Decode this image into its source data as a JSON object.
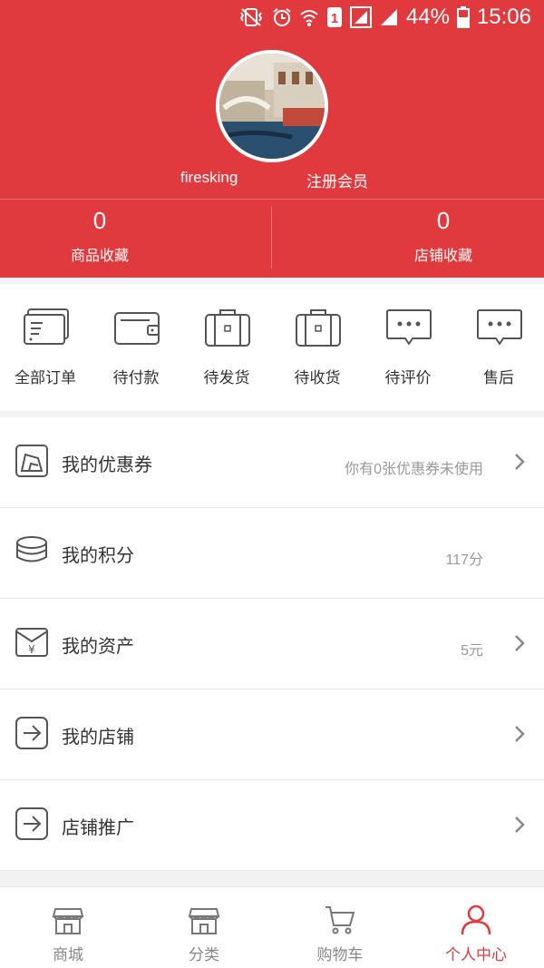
{
  "status_bar": {
    "battery": "44%",
    "time": "15:06",
    "sim": "1"
  },
  "profile": {
    "username": "firesking",
    "member_link": "注册会员"
  },
  "stats": [
    {
      "value": "0",
      "label": "商品收藏"
    },
    {
      "value": "0",
      "label": "店铺收藏"
    }
  ],
  "orders": [
    {
      "label": "全部订单",
      "icon": "order-list-icon"
    },
    {
      "label": "待付款",
      "icon": "wallet-icon"
    },
    {
      "label": "待发货",
      "icon": "suitcase-icon"
    },
    {
      "label": "待收货",
      "icon": "suitcase-icon"
    },
    {
      "label": "待评价",
      "icon": "chat-bubble-icon"
    },
    {
      "label": "售后",
      "icon": "chat-bubble-icon"
    }
  ],
  "menu": [
    {
      "label": "我的优惠券",
      "value": "你有0张优惠券未使用",
      "icon": "coupon-icon"
    },
    {
      "label": "我的积分",
      "value": "117分",
      "icon": "coins-icon"
    },
    {
      "label": "我的资产",
      "value": "5元",
      "icon": "envelope-yen-icon"
    },
    {
      "label": "我的店铺",
      "value": "",
      "icon": "store-arrow-icon"
    },
    {
      "label": "店铺推广",
      "value": "",
      "icon": "store-arrow-icon"
    }
  ],
  "bottom_nav": [
    {
      "label": "商城",
      "icon": "shop-icon"
    },
    {
      "label": "分类",
      "icon": "shop-icon"
    },
    {
      "label": "购物车",
      "icon": "cart-icon"
    },
    {
      "label": "个人中心",
      "icon": "person-icon",
      "active": true
    }
  ],
  "colors": {
    "brand": "#e13a3e",
    "text": "#333333",
    "muted": "#999999"
  }
}
